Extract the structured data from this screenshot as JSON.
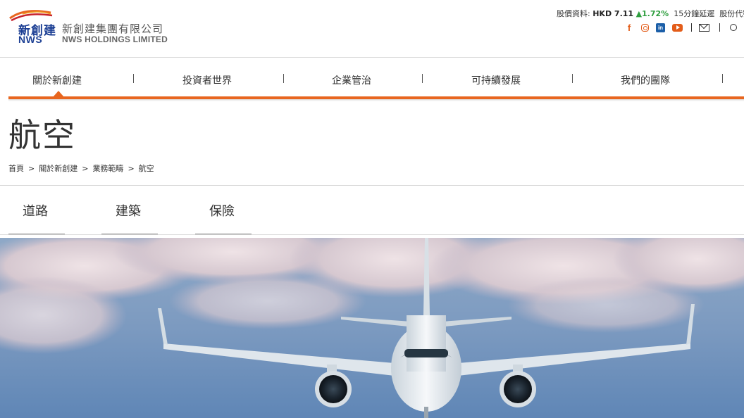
{
  "brand": {
    "cn_mark": "新創建",
    "en_mark": "NWS",
    "cn_name": "新創建集團有限公司",
    "en_name": "NWS HOLDINGS LIMITED",
    "accent_color": "#e8661f",
    "brand_blue": "#1c3f94"
  },
  "stock": {
    "label": "股價資料:",
    "price": "HKD 7.11",
    "change_arrow": "▲",
    "change": "1.72%",
    "delay": "15分鐘延遲",
    "code": "股份代號"
  },
  "social": {
    "icons": [
      "facebook-icon",
      "instagram-icon",
      "linkedin-icon",
      "youtube-icon",
      "mail-icon",
      "search-icon"
    ],
    "facebook_glyph": "f",
    "linkedin_glyph": "in"
  },
  "nav": {
    "items": [
      "關於新創建",
      "投資者世界",
      "企業管治",
      "可持續發展",
      "我們的團隊"
    ],
    "active_index": 0
  },
  "page": {
    "title": "航空"
  },
  "breadcrumb": [
    "首頁",
    "關於新創建",
    "業務範疇",
    "航空"
  ],
  "breadcrumb_separator": ">",
  "subtabs": [
    "道路",
    "建築",
    "保險"
  ]
}
